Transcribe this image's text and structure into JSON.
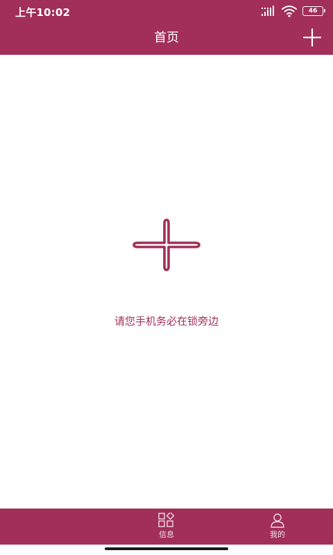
{
  "status_bar": {
    "time": "上午10:02",
    "battery_level": "46",
    "icons": [
      "signal-icon",
      "wifi-icon",
      "battery-icon"
    ]
  },
  "header": {
    "title": "首页",
    "action_icon": "plus-icon"
  },
  "main": {
    "center_icon": "plus-icon",
    "hint": "请您手机务必在锁旁边"
  },
  "tabbar": {
    "tabs": [
      {
        "label": "信息",
        "icon": "grid-icon"
      },
      {
        "label": "我的",
        "icon": "user-icon"
      }
    ]
  },
  "colors": {
    "accent": "#A12F58",
    "background": "#FFFFFF"
  }
}
